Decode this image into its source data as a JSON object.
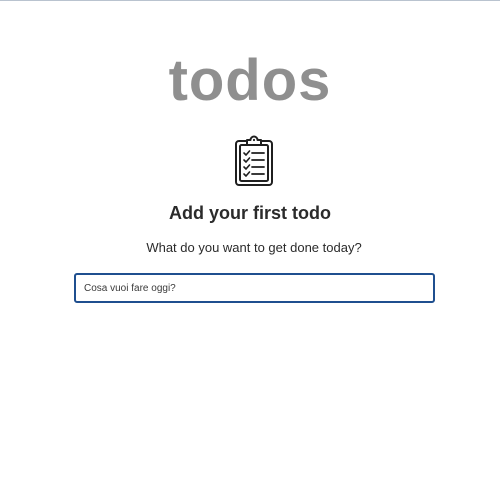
{
  "app": {
    "title": "todos"
  },
  "empty_state": {
    "icon": "clipboard-checklist-icon",
    "heading": "Add your first todo",
    "subtext": "What do you want to get done today?"
  },
  "new_todo": {
    "value": "",
    "placeholder": "Cosa vuoi fare oggi?"
  },
  "colors": {
    "title": "#8f8f8f",
    "text": "#2b2b2b",
    "input_border": "#1f4f8f"
  }
}
